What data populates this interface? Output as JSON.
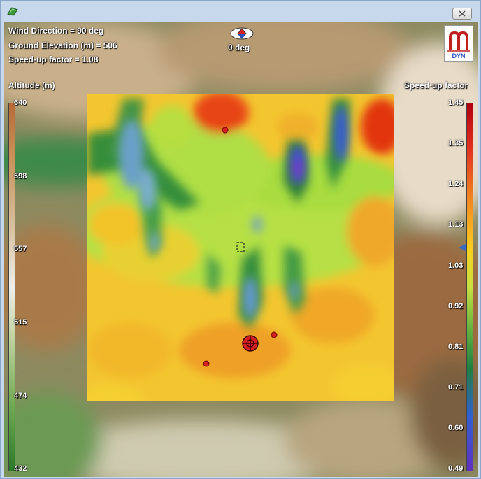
{
  "window": {
    "close_icon": "close-x-icon",
    "app_icon": "map-app-icon"
  },
  "hud": {
    "wind_direction": "Wind Direction = 90 deg",
    "ground_elevation": "Ground Elevation (m) = 506",
    "speedup": "Speed-up factor = 1.08",
    "compass_label": "0 deg"
  },
  "altitude_scale": {
    "title": "Altitude (m)",
    "ticks": [
      "640",
      "598",
      "557",
      "515",
      "474",
      "432"
    ]
  },
  "speedup_scale": {
    "title": "Speed-up factor",
    "ticks": [
      "1.45",
      "1.35",
      "1.24",
      "1.13",
      "1.03",
      "0.92",
      "0.81",
      "0.71",
      "0.60",
      "0.49"
    ]
  },
  "logo": {
    "text": "DYN"
  },
  "colors": {
    "window_frame": "#c7d8ec",
    "overlay_high": "#e03010",
    "overlay_mid": "#f5d020",
    "overlay_low": "#2a7a30",
    "overlay_min": "#5a3ad8",
    "mast_marker": "#d42020"
  }
}
